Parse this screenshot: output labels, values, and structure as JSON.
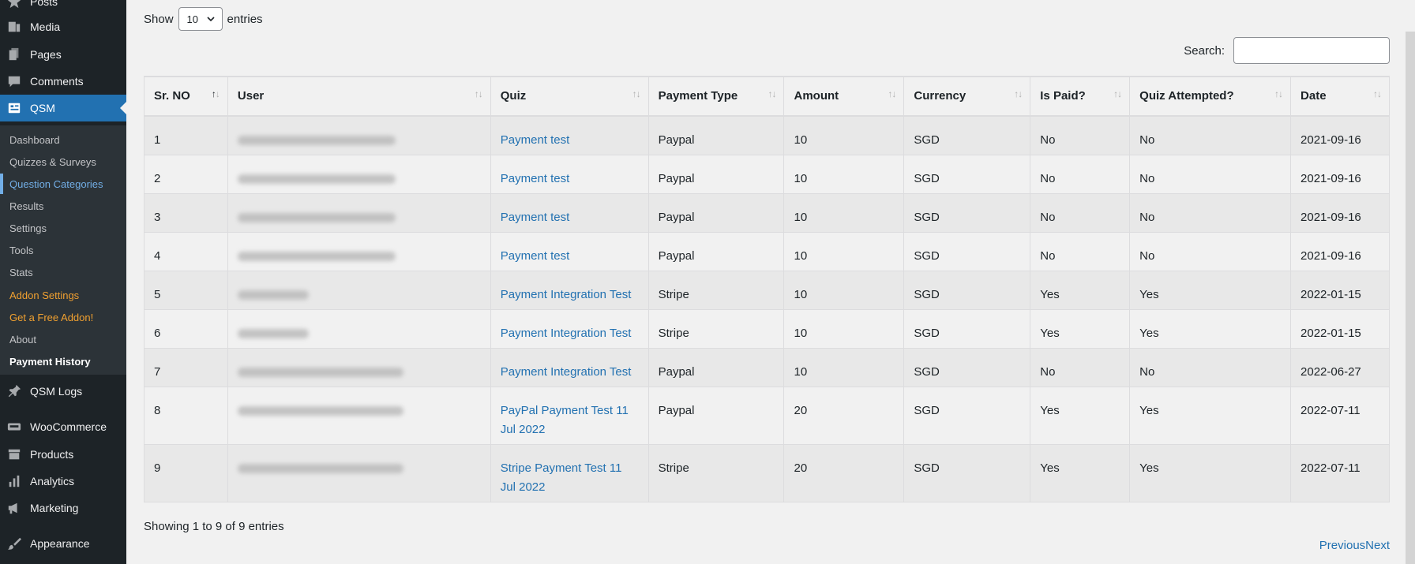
{
  "sidebar": {
    "posts": "Posts",
    "media": "Media",
    "pages": "Pages",
    "comments": "Comments",
    "qsm": "QSM",
    "submenu": [
      "Dashboard",
      "Quizzes & Surveys",
      "Question Categories",
      "Results",
      "Settings",
      "Tools",
      "Stats",
      "Addon Settings",
      "Get a Free Addon!",
      "About",
      "Payment History"
    ],
    "qsm_logs": "QSM Logs",
    "woocommerce": "WooCommerce",
    "products": "Products",
    "analytics": "Analytics",
    "marketing": "Marketing",
    "appearance": "Appearance"
  },
  "length": {
    "show": "Show",
    "value": "10",
    "entries": "entries"
  },
  "search": {
    "label": "Search:"
  },
  "table": {
    "headers": [
      "Sr. NO",
      "User",
      "Quiz",
      "Payment Type",
      "Amount",
      "Currency",
      "Is Paid?",
      "Quiz Attempted?",
      "Date"
    ],
    "rows": [
      {
        "sr": "1",
        "quiz": "Payment test",
        "ptype": "Paypal",
        "amount": "10",
        "currency": "SGD",
        "paid": "No",
        "attempted": "No",
        "date": "2021-09-16"
      },
      {
        "sr": "2",
        "quiz": "Payment test",
        "ptype": "Paypal",
        "amount": "10",
        "currency": "SGD",
        "paid": "No",
        "attempted": "No",
        "date": "2021-09-16"
      },
      {
        "sr": "3",
        "quiz": "Payment test",
        "ptype": "Paypal",
        "amount": "10",
        "currency": "SGD",
        "paid": "No",
        "attempted": "No",
        "date": "2021-09-16"
      },
      {
        "sr": "4",
        "quiz": "Payment test",
        "ptype": "Paypal",
        "amount": "10",
        "currency": "SGD",
        "paid": "No",
        "attempted": "No",
        "date": "2021-09-16"
      },
      {
        "sr": "5",
        "quiz": "Payment Integration Test",
        "ptype": "Stripe",
        "amount": "10",
        "currency": "SGD",
        "paid": "Yes",
        "attempted": "Yes",
        "date": "2022-01-15"
      },
      {
        "sr": "6",
        "quiz": "Payment Integration Test",
        "ptype": "Stripe",
        "amount": "10",
        "currency": "SGD",
        "paid": "Yes",
        "attempted": "Yes",
        "date": "2022-01-15"
      },
      {
        "sr": "7",
        "quiz": "Payment Integration Test",
        "ptype": "Paypal",
        "amount": "10",
        "currency": "SGD",
        "paid": "No",
        "attempted": "No",
        "date": "2022-06-27"
      },
      {
        "sr": "8",
        "quiz": "PayPal Payment Test 11 Jul 2022",
        "ptype": "Paypal",
        "amount": "20",
        "currency": "SGD",
        "paid": "Yes",
        "attempted": "Yes",
        "date": "2022-07-11"
      },
      {
        "sr": "9",
        "quiz": "Stripe Payment Test 11 Jul 2022",
        "ptype": "Stripe",
        "amount": "20",
        "currency": "SGD",
        "paid": "Yes",
        "attempted": "Yes",
        "date": "2022-07-11"
      }
    ]
  },
  "info": "Showing 1 to 9 of 9 entries",
  "paging": {
    "previous": "Previous",
    "next": "Next"
  }
}
